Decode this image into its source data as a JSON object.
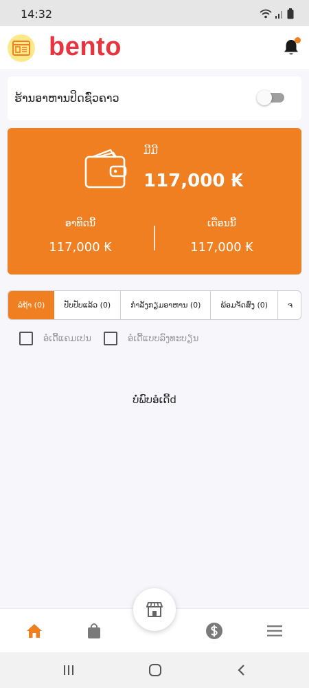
{
  "status_bar": {
    "time": "14:32"
  },
  "header": {
    "brand": "bento"
  },
  "closure": {
    "label": "ຮ້ານອາຫານປິດຊົ່ວຄາວ",
    "enabled": false
  },
  "wallet": {
    "label": "ມີມີ",
    "amount": "117,000 ₭",
    "today_label": "ອາທິດນີ້",
    "today_value": "117,000 ₭",
    "month_label": "ເດືອນນີ້",
    "month_value": "117,000 ₭"
  },
  "tabs": [
    {
      "label": "ລໍຖ້າ (0)",
      "active": true
    },
    {
      "label": "ປັບປັບແລ້ວ (0)",
      "active": false
    },
    {
      "label": "ກຳລັງກຽມອາຫານ (0)",
      "active": false
    },
    {
      "label": "ພ້ອມຈັດສົ່ງ (0)",
      "active": false
    },
    {
      "label": "ຈ",
      "active": false
    }
  ],
  "filters": [
    {
      "label": "ອໍເດີ້ແຄມເປນ",
      "checked": false
    },
    {
      "label": "ອໍເດີ້ແບບລົງທະບຽນ",
      "checked": false
    }
  ],
  "empty_message": "ບໍ່ພົບອໍເດີ້d",
  "bottom_nav": [
    "home-icon",
    "shopping-bag-icon",
    "store-icon",
    "dollar-icon",
    "menu-icon"
  ],
  "colors": {
    "accent": "#f07f21",
    "brand": "#e8343f"
  }
}
